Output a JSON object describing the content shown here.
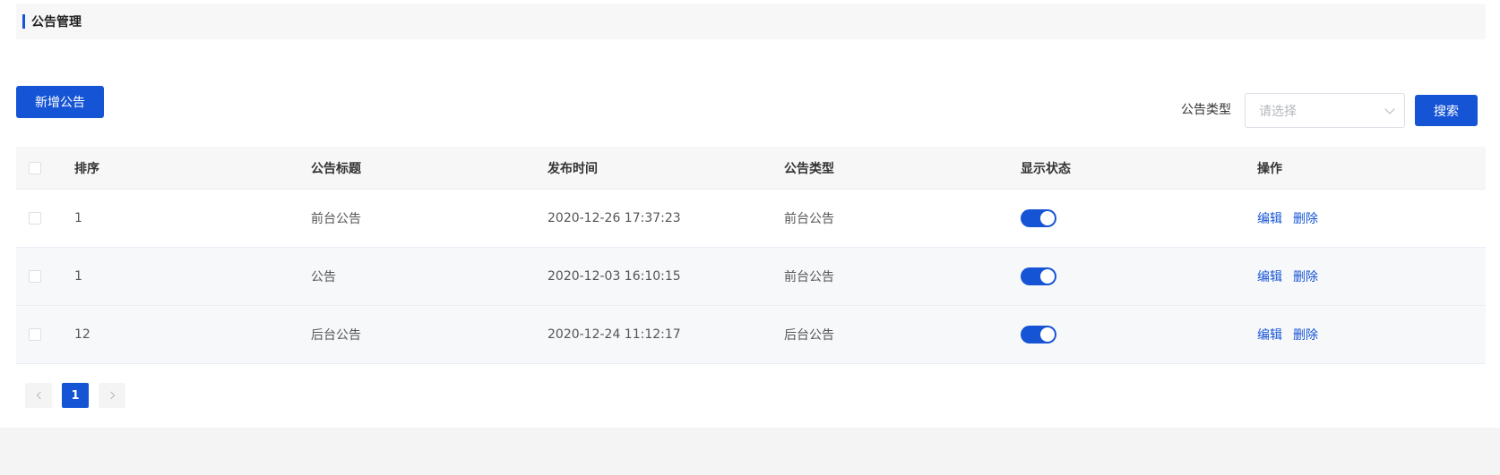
{
  "header": {
    "title": "公告管理"
  },
  "toolbar": {
    "add_label": "新增公告",
    "filter_label": "公告类型",
    "select_placeholder": "请选择",
    "search_label": "搜索"
  },
  "table": {
    "columns": [
      "排序",
      "公告标题",
      "发布时间",
      "公告类型",
      "显示状态",
      "操作"
    ],
    "rows": [
      {
        "seq": "1",
        "title": "前台公告",
        "time": "2020-12-26 17:37:23",
        "type": "前台公告",
        "status_on": true,
        "edit": "编辑",
        "delete": "删除"
      },
      {
        "seq": "1",
        "title": "公告",
        "time": "2020-12-03 16:10:15",
        "type": "前台公告",
        "status_on": true,
        "edit": "编辑",
        "delete": "删除"
      },
      {
        "seq": "12",
        "title": "后台公告",
        "time": "2020-12-24 11:12:17",
        "type": "后台公告",
        "status_on": true,
        "edit": "编辑",
        "delete": "删除"
      }
    ]
  },
  "pagination": {
    "current_page": "1"
  },
  "colors": {
    "primary": "#1654d6",
    "page_bg": "#f4f4f5",
    "header_bg": "#f7f7f8"
  }
}
